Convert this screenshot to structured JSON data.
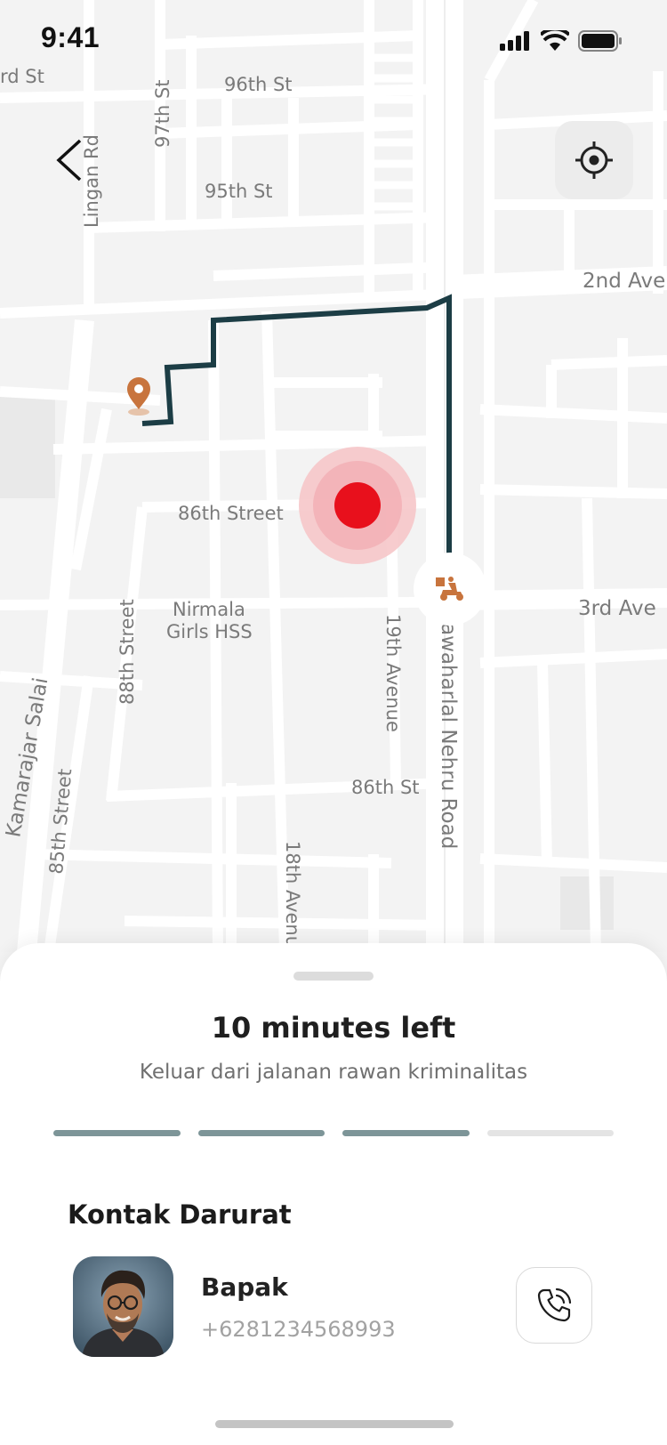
{
  "status_bar": {
    "time": "9:41"
  },
  "map": {
    "streets": {
      "rd_st": "rd St",
      "st_96": "96th St",
      "st_97": "97th St",
      "lingan_rd": "Lingan Rd",
      "st_95": "95th St",
      "ave_2nd": "2nd Ave",
      "street_86": "86th Street",
      "ave_3rd": "3rd Ave",
      "nirmala_1": "Nirmala",
      "nirmala_2": "Girls HSS",
      "street_88": "88th Street",
      "ave_19": "19th Avenue",
      "nehru_rd": "awaharlal Nehru Road",
      "kamarajar": "Kamarajar Salai",
      "street_85": "85th Street",
      "st_86": "86th St",
      "ave_18": "18th Avenu"
    },
    "danger_color": "#e8101c",
    "route_color": "#1c3d45",
    "pin_color": "#c8743d"
  },
  "sheet": {
    "title": "10 minutes left",
    "subtitle": "Keluar dari jalanan rawan kriminalitas",
    "progress_steps_total": 4,
    "progress_steps_done": 3,
    "section_title": "Kontak Darurat",
    "contact": {
      "name": "Bapak",
      "phone": "+6281234568993"
    }
  }
}
